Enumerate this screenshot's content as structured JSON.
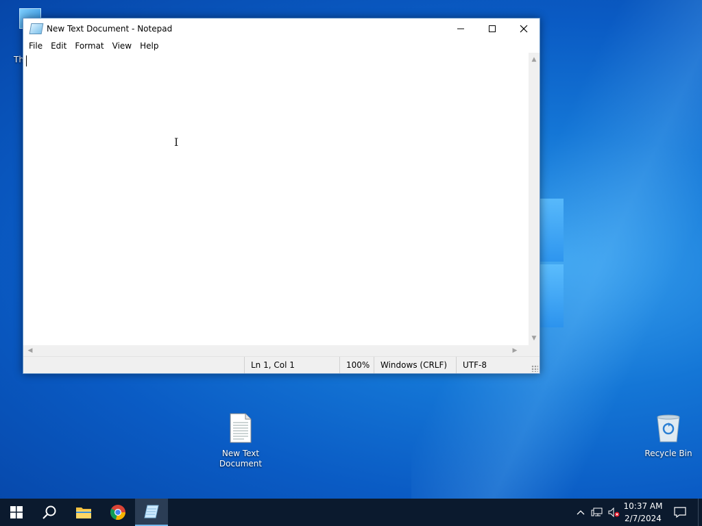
{
  "desktop": {
    "this_pc_label": "Th",
    "icons": [
      {
        "label_line1": "New Text",
        "label_line2": "Document"
      },
      {
        "label_line1": "Recycle Bin",
        "label_line2": ""
      }
    ]
  },
  "window": {
    "title": "New Text Document - Notepad",
    "menu": [
      "File",
      "Edit",
      "Format",
      "View",
      "Help"
    ],
    "content": "",
    "status": {
      "position": "Ln 1, Col 1",
      "zoom": "100%",
      "line_ending": "Windows (CRLF)",
      "encoding": "UTF-8"
    }
  },
  "taskbar": {
    "time": "10:37 AM",
    "date": "2/7/2024"
  },
  "colors": {
    "accent": "#76b9ed",
    "taskbar": "#0b1a2e"
  }
}
